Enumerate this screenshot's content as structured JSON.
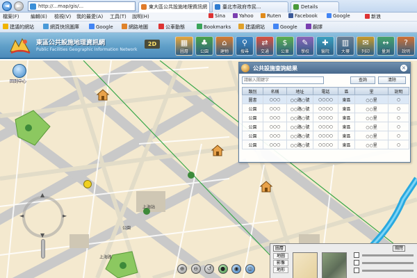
{
  "browser": {
    "url": "http://...map/gis/...",
    "tabs": [
      {
        "label": "東大區公共設施地理資訊網",
        "active": true
      },
      {
        "label": "臺北市政府市民...",
        "active": false
      },
      {
        "label": "Details",
        "active": false
      }
    ],
    "menu": [
      "檔案(F)",
      "編輯(E)",
      "檢視(V)",
      "我的最愛(A)",
      "工具(T)",
      "說明(H)"
    ],
    "links": [
      "Sina",
      "Yahoo",
      "Ruten",
      "Facebook",
      "Google",
      "新浪"
    ],
    "favorites": [
      "建議的網站",
      "網頁快訊圖庫",
      "Google",
      "網路地圖",
      "公車動態",
      "Bookmarks",
      "建議網站",
      "Google",
      "翻譯"
    ]
  },
  "app": {
    "title": "東區公共設施地理資訊網",
    "subtitle": "Public Facilities Geographic Information Network",
    "badge": "2D",
    "tools": [
      {
        "label": "圖層",
        "glyph": "▦",
        "color": "#e8a63a"
      },
      {
        "label": "公園",
        "glyph": "♣",
        "color": "#4aa348"
      },
      {
        "label": "建物",
        "glyph": "⌂",
        "color": "#d77b2e"
      },
      {
        "label": "搜尋",
        "glyph": "⚲",
        "color": "#3d86c6"
      },
      {
        "label": "交通",
        "glyph": "⇄",
        "color": "#d9503f"
      },
      {
        "label": "公車",
        "glyph": "$",
        "color": "#5bb04d"
      },
      {
        "label": "學校",
        "glyph": "✎",
        "color": "#8a63b8"
      },
      {
        "label": "醫院",
        "glyph": "✚",
        "color": "#3aa0c0"
      },
      {
        "label": "大樓",
        "glyph": "▥",
        "color": "#6b7f94"
      },
      {
        "label": "列印",
        "glyph": "✉",
        "color": "#c89a2a"
      },
      {
        "label": "量測",
        "glyph": "↔",
        "color": "#47a36a"
      },
      {
        "label": "說明",
        "glyph": "?",
        "color": "#d07033"
      }
    ]
  },
  "map": {
    "compass_label": "回到中心",
    "zoom_arrows": [
      "◄",
      "►",
      "▲",
      "▼"
    ],
    "bottom_tools": [
      "⊕",
      "⊖",
      "↺",
      "●",
      "◉",
      "◎"
    ],
    "labels": [
      "上海站",
      "公園",
      "上海路"
    ]
  },
  "result_panel": {
    "title": "公共設施查詢結果",
    "close": "×",
    "search_placeholder": "請輸入關鍵字",
    "buttons": [
      "查詢",
      "清除"
    ],
    "columns": [
      "類別",
      "名稱",
      "地址",
      "電話",
      "區",
      "里",
      "說明"
    ],
    "rows": [
      [
        "圖書",
        "○○○",
        "○○路○號",
        "○○○○",
        "東區",
        "○○里",
        "○"
      ],
      [
        "公園",
        "○○○",
        "○○路○號",
        "○○○○",
        "東區",
        "○○里",
        "○"
      ],
      [
        "公園",
        "○○○",
        "○○路○號",
        "○○○○",
        "東區",
        "○○里",
        "○"
      ],
      [
        "公園",
        "○○○",
        "○○路○號",
        "○○○○",
        "東區",
        "○○里",
        "○"
      ],
      [
        "公園",
        "○○○",
        "○○路○號",
        "○○○○",
        "東區",
        "○○里",
        "○"
      ],
      [
        "公園",
        "○○○",
        "○○路○號",
        "○○○○",
        "東區",
        "○○里",
        "○"
      ]
    ]
  },
  "overview": {
    "top_buttons": [
      "圖層",
      "關閉"
    ],
    "list": [
      "地圖",
      "影像",
      "地形"
    ],
    "slider_labels": [
      "",
      "",
      ""
    ]
  }
}
